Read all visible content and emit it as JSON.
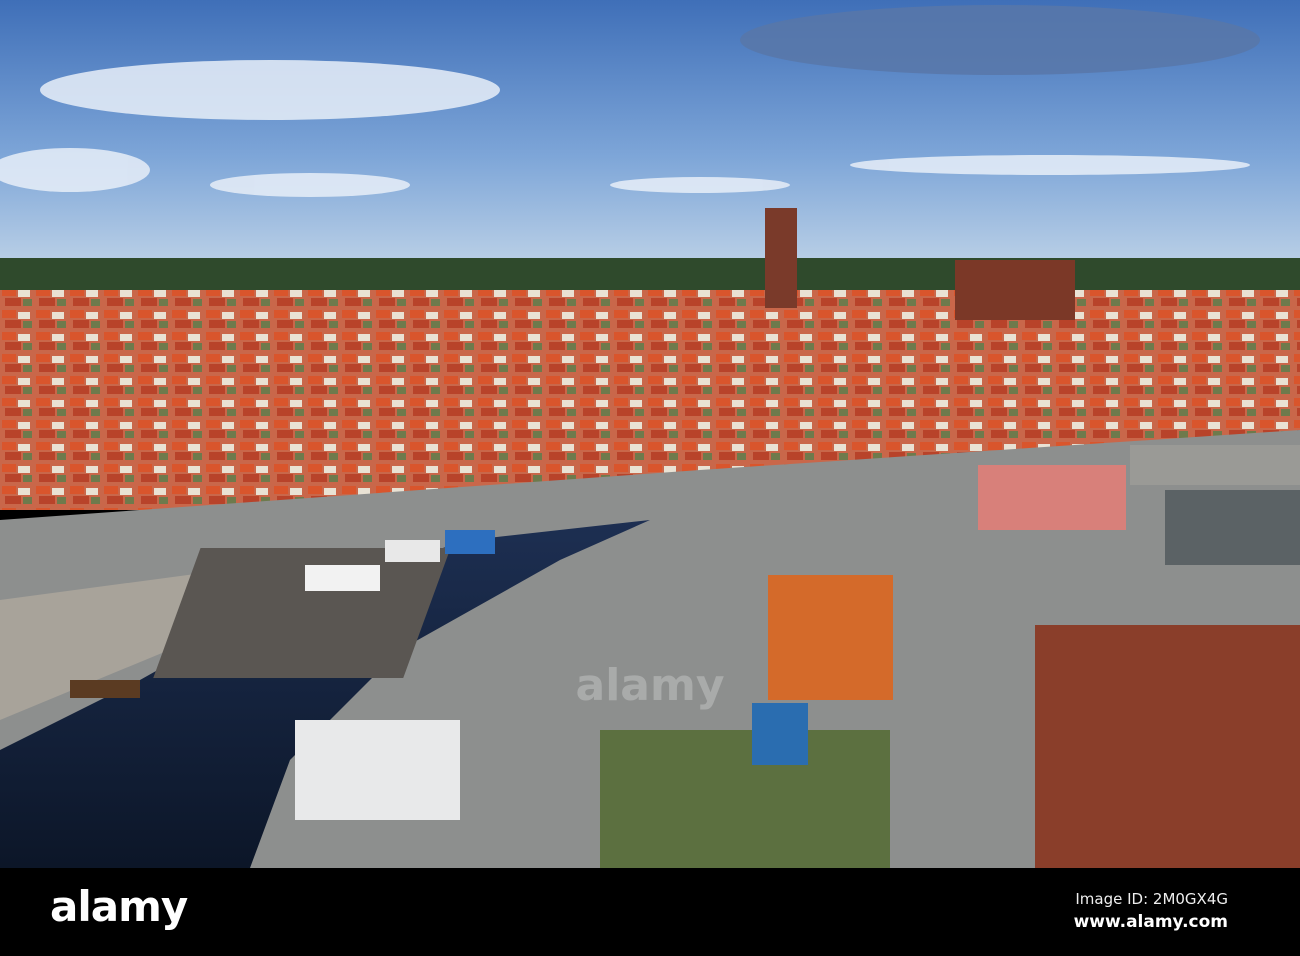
{
  "watermark": {
    "brand": "alamy"
  },
  "footer": {
    "logo": "alamy",
    "image_id": "Image ID: 2M0GX4G",
    "website": "www.alamy.com"
  }
}
